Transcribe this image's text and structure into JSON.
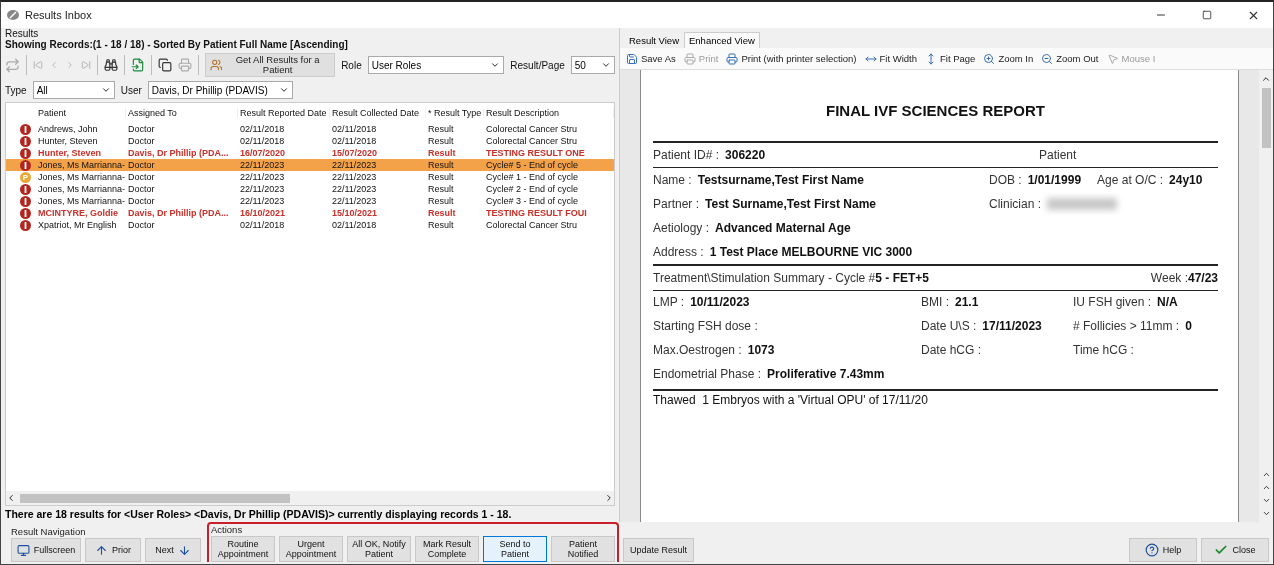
{
  "window": {
    "title": "Results Inbox"
  },
  "results": {
    "group_label": "Results",
    "showing": "Showing Records:(1 - 18 / 18) - Sorted By Patient Full Name [Ascending]",
    "get_all_button": "Get All Results for a Patient",
    "role": {
      "label": "Role",
      "value": "User Roles"
    },
    "per_page": {
      "label": "Result/Page",
      "value": "50"
    },
    "type": {
      "label": "Type",
      "value": "All"
    },
    "user": {
      "label": "User",
      "value": "Davis, Dr Phillip (PDAVIS)"
    },
    "columns": [
      "Patient",
      "Assigned To",
      "Result Reported Date",
      "Result Collected Date",
      "* Result Type",
      "Result Description"
    ],
    "rows": [
      {
        "kind": "alert",
        "flagged": false,
        "selected": false,
        "cells": [
          "Andrews, John",
          "Doctor",
          "02/11/2018",
          "02/11/2018",
          "Result",
          "Colorectal Cancer Stru"
        ]
      },
      {
        "kind": "alert",
        "flagged": false,
        "selected": false,
        "cells": [
          "Hunter, Steven",
          "Doctor",
          "02/11/2018",
          "02/11/2018",
          "Result",
          "Colorectal Cancer Stru"
        ]
      },
      {
        "kind": "alert",
        "flagged": true,
        "selected": false,
        "cells": [
          "Hunter, Steven",
          "Davis, Dr Phillip (PDA...",
          "16/07/2020",
          "15/07/2020",
          "Result",
          "TESTING RESULT ONE"
        ]
      },
      {
        "kind": "alert",
        "flagged": false,
        "selected": true,
        "cells": [
          "Jones, Ms Marrianna-",
          "Doctor",
          "22/11/2023",
          "22/11/2023",
          "Result",
          "Cycle# 5 - End of cycle"
        ]
      },
      {
        "kind": "pending",
        "badge": "P",
        "flagged": false,
        "selected": false,
        "cells": [
          "Jones, Ms Marrianna-",
          "Doctor",
          "22/11/2023",
          "22/11/2023",
          "Result",
          "Cycle# 1 - End of cycle"
        ]
      },
      {
        "kind": "alert",
        "flagged": false,
        "selected": false,
        "cells": [
          "Jones, Ms Marrianna-",
          "Doctor",
          "22/11/2023",
          "22/11/2023",
          "Result",
          "Cycle# 2 - End of cycle"
        ]
      },
      {
        "kind": "alert",
        "flagged": false,
        "selected": false,
        "cells": [
          "Jones, Ms Marrianna-",
          "Doctor",
          "22/11/2023",
          "22/11/2023",
          "Result",
          "Cycle# 3 - End of cycle"
        ]
      },
      {
        "kind": "alert",
        "flagged": true,
        "selected": false,
        "cells": [
          "MCINTYRE, Goldie",
          "Davis, Dr Phillip (PDA...",
          "16/10/2021",
          "15/10/2021",
          "Result",
          "TESTING RESULT FOUI"
        ]
      },
      {
        "kind": "alert",
        "flagged": false,
        "selected": false,
        "cells": [
          "Xpatriot, Mr English",
          "Doctor",
          "02/11/2018",
          "02/11/2018",
          "Result",
          "Colorectal Cancer Stru"
        ]
      }
    ],
    "summary": "There are 18 results for <User Roles> <Davis, Dr Phillip (PDAVIS)> currently displaying records 1 - 18."
  },
  "viewer": {
    "tabs": [
      {
        "label": "Result View",
        "selected": false
      },
      {
        "label": "Enhanced View",
        "selected": true
      }
    ],
    "tools": [
      {
        "kind": "save",
        "label": "Save As",
        "disabled": false
      },
      {
        "kind": "print",
        "label": "Print",
        "disabled": true
      },
      {
        "kind": "print",
        "label": "Print (with printer selection)",
        "disabled": false
      },
      {
        "kind": "fit-width",
        "label": "Fit Width",
        "disabled": false
      },
      {
        "kind": "fit-page",
        "label": "Fit Page",
        "disabled": false
      },
      {
        "kind": "zoom-in",
        "label": "Zoom In",
        "disabled": false
      },
      {
        "kind": "zoom-out",
        "label": "Zoom Out",
        "disabled": false
      },
      {
        "kind": "pointer",
        "label": "Mouse I",
        "disabled": true
      }
    ]
  },
  "report": {
    "title": "FINAL IVF SCIENCES REPORT",
    "id_row": {
      "label": "Patient ID# :",
      "value": "306220",
      "note": "Patient"
    },
    "patient_rows": [
      [
        {
          "label": "Name :",
          "value": "Testsurname,Test First Name"
        },
        {
          "label": "DOB :",
          "value": "1/01/1999"
        },
        {
          "label": "Age at O/C :",
          "value": "24y10"
        }
      ],
      [
        {
          "label": "Partner :",
          "value": "Test Surname,Test First Name"
        },
        {
          "label": "Clinician :",
          "redacted": true
        }
      ],
      [
        {
          "label": "Aetiology :",
          "value": "Advanced Maternal Age"
        }
      ],
      [
        {
          "label": "Address :",
          "value": "1 Test Place MELBOURNE VIC 3000"
        }
      ]
    ],
    "summary": {
      "label": "Treatment\\Stimulation Summary - Cycle #",
      "value": "5 - FET+5",
      "week_label": "Week :",
      "week": "47/23"
    },
    "cycle_columns": [
      [
        {
          "label": "LMP :",
          "value": "10/11/2023"
        },
        {
          "label": "Starting FSH dose :"
        },
        {
          "label": "Max.Oestrogen :",
          "value": "1073"
        },
        {
          "label": "Endometrial Phase :",
          "value": "Proliferative 7.43mm"
        }
      ],
      [
        {
          "label": "BMI :",
          "value": "21.1"
        },
        {
          "label": "Date U\\S :",
          "value": "17/11/2023"
        },
        {
          "label": "Date hCG :"
        }
      ],
      [
        {
          "label": "IU FSH given :",
          "value": "N/A"
        },
        {
          "label": "# Follicies > 11mm :",
          "value": "0"
        },
        {
          "label": "Time hCG :"
        }
      ]
    ],
    "note": "Thawed  1 Embryos with a 'Virtual OPU' of 17/11/20"
  },
  "navigation": {
    "label": "Result Navigation",
    "buttons": [
      {
        "kind": "fullscreen",
        "label": "Fullscreen"
      },
      {
        "kind": "prior",
        "label": "Prior"
      },
      {
        "kind": "next",
        "label": "Next"
      }
    ]
  },
  "actions": {
    "label": "Actions",
    "buttons": [
      {
        "label": "Routine Appointment",
        "selected": false
      },
      {
        "label": "Urgent Appointment",
        "selected": false
      },
      {
        "label": "All OK, Notify Patient",
        "selected": false
      },
      {
        "label": "Mark Result Complete",
        "selected": false
      },
      {
        "label": "Send to Patient",
        "selected": true
      },
      {
        "label": "Patient Notified",
        "selected": false
      }
    ]
  },
  "update_button": "Update Result",
  "footer_buttons": [
    {
      "kind": "help",
      "label": "Help"
    },
    {
      "kind": "close",
      "label": "Close"
    }
  ]
}
